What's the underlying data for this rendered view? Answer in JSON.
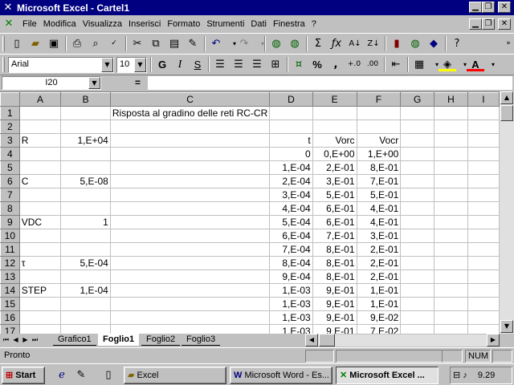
{
  "window": {
    "title": "Microsoft Excel - Cartel1"
  },
  "menu": [
    "File",
    "Modifica",
    "Visualizza",
    "Inserisci",
    "Formato",
    "Strumenti",
    "Dati",
    "Finestra",
    "?"
  ],
  "formatting": {
    "font": "Arial",
    "size": "10",
    "bold": "G",
    "italic": "I",
    "underline": "S"
  },
  "formula_bar": {
    "cell_ref": "I20",
    "equals": "=",
    "content": ""
  },
  "columns": [
    "A",
    "B",
    "C",
    "D",
    "E",
    "F",
    "G",
    "H",
    "I"
  ],
  "rows": [
    {
      "n": "1",
      "A": "",
      "B": "",
      "C": "Risposta al gradino delle reti RC-CR",
      "D": "",
      "E": "",
      "F": ""
    },
    {
      "n": "2",
      "A": "",
      "B": "",
      "C": "",
      "D": "",
      "E": "",
      "F": ""
    },
    {
      "n": "3",
      "A": "R",
      "B": "1,E+04",
      "C": "",
      "D": "t",
      "E": "Vorc",
      "F": "Vocr"
    },
    {
      "n": "4",
      "A": "",
      "B": "",
      "C": "",
      "D": "0",
      "E": "0,E+00",
      "F": "1,E+00"
    },
    {
      "n": "5",
      "A": "",
      "B": "",
      "C": "",
      "D": "1,E-04",
      "E": "2,E-01",
      "F": "8,E-01"
    },
    {
      "n": "6",
      "A": "C",
      "B": "5,E-08",
      "C": "",
      "D": "2,E-04",
      "E": "3,E-01",
      "F": "7,E-01"
    },
    {
      "n": "7",
      "A": "",
      "B": "",
      "C": "",
      "D": "3,E-04",
      "E": "5,E-01",
      "F": "5,E-01"
    },
    {
      "n": "8",
      "A": "",
      "B": "",
      "C": "",
      "D": "4,E-04",
      "E": "6,E-01",
      "F": "4,E-01"
    },
    {
      "n": "9",
      "A": "VDC",
      "B": "1",
      "C": "",
      "D": "5,E-04",
      "E": "6,E-01",
      "F": "4,E-01"
    },
    {
      "n": "10",
      "A": "",
      "B": "",
      "C": "",
      "D": "6,E-04",
      "E": "7,E-01",
      "F": "3,E-01"
    },
    {
      "n": "11",
      "A": "",
      "B": "",
      "C": "",
      "D": "7,E-04",
      "E": "8,E-01",
      "F": "2,E-01"
    },
    {
      "n": "12",
      "A": "τ",
      "B": "5,E-04",
      "C": "",
      "D": "8,E-04",
      "E": "8,E-01",
      "F": "2,E-01"
    },
    {
      "n": "13",
      "A": "",
      "B": "",
      "C": "",
      "D": "9,E-04",
      "E": "8,E-01",
      "F": "2,E-01"
    },
    {
      "n": "14",
      "A": "STEP",
      "B": "1,E-04",
      "C": "",
      "D": "1,E-03",
      "E": "9,E-01",
      "F": "1,E-01"
    },
    {
      "n": "15",
      "A": "",
      "B": "",
      "C": "",
      "D": "1,E-03",
      "E": "9,E-01",
      "F": "1,E-01"
    },
    {
      "n": "16",
      "A": "",
      "B": "",
      "C": "",
      "D": "1,E-03",
      "E": "9,E-01",
      "F": "9,E-02"
    },
    {
      "n": "17",
      "A": "",
      "B": "",
      "C": "",
      "D": "1,E-03",
      "E": "9,E-01",
      "F": "7,E-02"
    }
  ],
  "sheet_tabs": [
    "Grafico1",
    "Foglio1",
    "Foglio2",
    "Foglio3"
  ],
  "active_tab": "Foglio1",
  "status": {
    "text": "Pronto",
    "num": "NUM"
  },
  "taskbar": {
    "start": "Start",
    "items": [
      "Excel",
      "Microsoft Word - Es...",
      "Microsoft Excel ..."
    ],
    "clock": "9.29"
  }
}
